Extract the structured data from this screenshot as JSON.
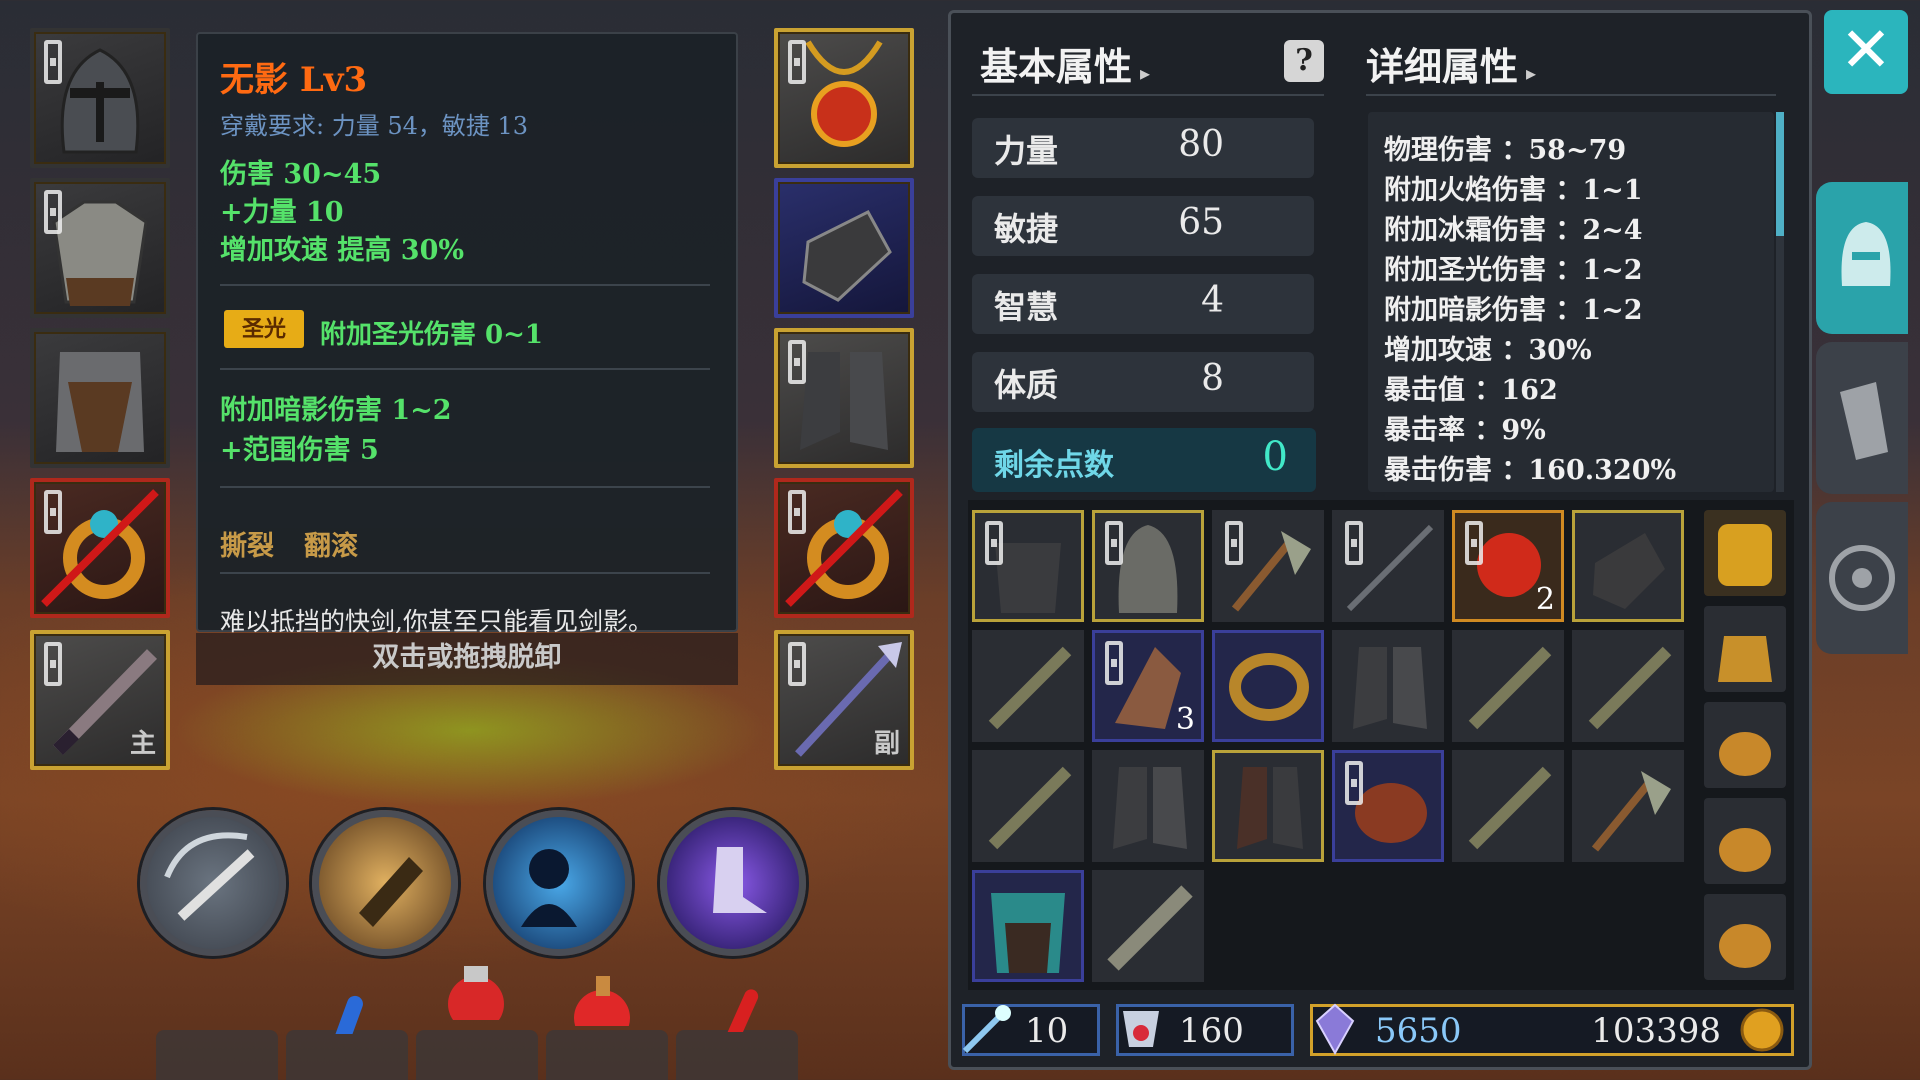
{
  "tooltip": {
    "title": "无影 Lv3",
    "requirement": "穿戴要求:   力量 54，敏捷 13",
    "lines1": [
      "伤害   30~45",
      "+力量 10",
      "增加攻速 提高 30%"
    ],
    "badge": "圣光",
    "badge_text": "附加圣光伤害 0~1",
    "lines2": [
      "附加暗影伤害  1~2",
      "+范围伤害  5"
    ],
    "skills": [
      "撕裂",
      "翻滚"
    ],
    "description": "难以抵挡的快剑,你甚至只能看见剑影。",
    "hint": "双击或拖拽脱卸"
  },
  "equip_tags": {
    "main": "主",
    "off": "副"
  },
  "icons": {
    "left_slots": [
      "helmet-icon",
      "chest-armor-icon",
      "leg-armor-icon",
      "ring-icon",
      "sword-icon"
    ],
    "right_slots": [
      "amulet-icon",
      "gloves-icon",
      "boots-icon",
      "ring-icon",
      "spear-icon"
    ],
    "skills": [
      "slash-skill-icon",
      "dash-skill-icon",
      "shadow-skill-icon",
      "speed-boots-skill-icon"
    ],
    "potions": [
      "blue-potion-icon",
      "red-flask-icon",
      "red-potion-icon",
      "red-vial-icon"
    ],
    "tabs": [
      "helmet-tab-icon",
      "gloves-tab-icon",
      "wheel-tab-icon"
    ]
  },
  "basic": {
    "header": "基本属性",
    "stats": [
      {
        "name": "力量",
        "value": "80"
      },
      {
        "name": "敏捷",
        "value": "65"
      },
      {
        "name": "智慧",
        "value": "4"
      },
      {
        "name": "体质",
        "value": "8"
      }
    ],
    "remain_label": "剩余点数",
    "remain_value": "0"
  },
  "help_icon": "question-icon",
  "detail": {
    "header": "详细属性",
    "lines": [
      "物理伤害 ：58~79",
      "附加火焰伤害 ：1~1",
      "附加冰霜伤害 ：2~4",
      "附加圣光伤害 ：1~2",
      "附加暗影伤害 ：1~2",
      "增加攻速 ：30%",
      "暴击值 ：162",
      "暴击率 ：9%",
      "暴击伤害 ：160.320%"
    ]
  },
  "inventory": {
    "quantities": {
      "r0c4": "2",
      "r1c1": "3"
    }
  },
  "bottom": {
    "skill_points": "10",
    "crystals": "160",
    "gems": "5650",
    "gold": "103398"
  },
  "colors": {
    "accent": "#2bb5bd",
    "title": "#ff6a12",
    "stat_green": "#55e26a",
    "gold_border": "#c9a232"
  }
}
